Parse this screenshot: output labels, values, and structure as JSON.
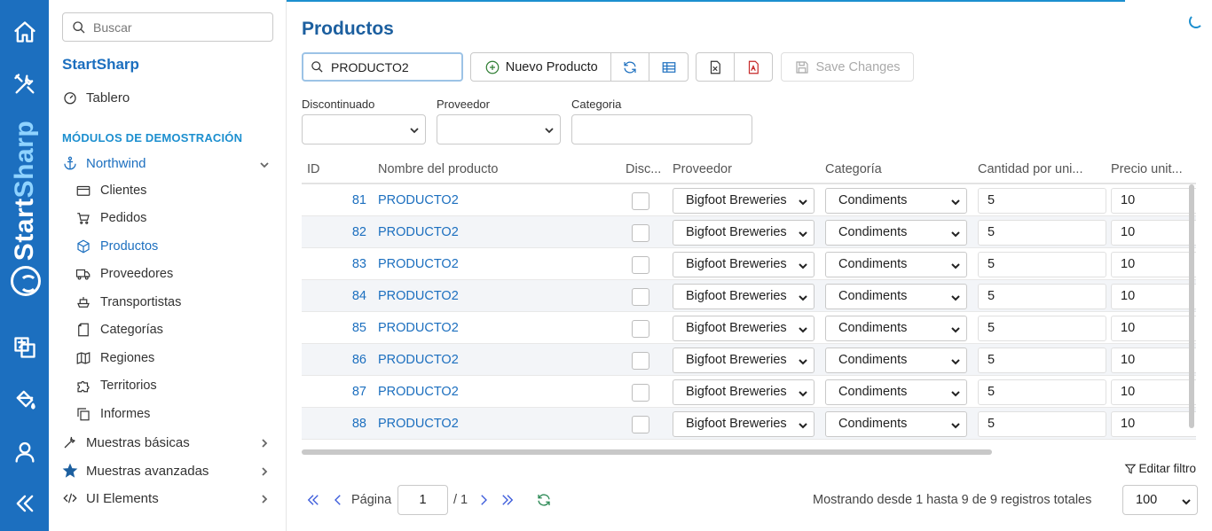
{
  "rail": {
    "brand_start": "Start",
    "brand_sharp": "Sharp",
    "icons": [
      "home-icon",
      "tools-icon",
      "translate-icon",
      "paint-bucket-icon",
      "user-icon",
      "collapse-icon"
    ]
  },
  "sidebar": {
    "search_placeholder": "Buscar",
    "title": "StartSharp",
    "dashboard": "Tablero",
    "section": "MÓDULOS DE DEMOSTRACIÓN",
    "northwind": "Northwind",
    "items": [
      {
        "label": "Clientes",
        "icon": "card-icon"
      },
      {
        "label": "Pedidos",
        "icon": "cart-icon"
      },
      {
        "label": "Productos",
        "icon": "cube-icon"
      },
      {
        "label": "Proveedores",
        "icon": "truck-icon"
      },
      {
        "label": "Transportistas",
        "icon": "ship-icon"
      },
      {
        "label": "Categorías",
        "icon": "folder-icon"
      },
      {
        "label": "Regiones",
        "icon": "map-icon"
      },
      {
        "label": "Territorios",
        "icon": "puzzle-icon"
      },
      {
        "label": "Informes",
        "icon": "copy-icon"
      }
    ],
    "basic": "Muestras básicas",
    "advanced": "Muestras avanzadas",
    "ui": "UI Elements"
  },
  "main": {
    "title": "Productos",
    "quick_search_value": "PRODUCTO2",
    "new_button": "Nuevo Producto",
    "save_changes": "Save Changes",
    "filters": {
      "discontinued_label": "Discontinuado",
      "supplier_label": "Proveedor",
      "category_label": "Categoria"
    },
    "columns": [
      "ID",
      "Nombre del producto",
      "Disc...",
      "Proveedor",
      "Categoría",
      "Cantidad por uni...",
      "Precio unit..."
    ],
    "rows": [
      {
        "id": "81",
        "name": "PRODUCTO2",
        "supplier": "Bigfoot Breweries",
        "category": "Condiments",
        "qty": "5",
        "price": "10"
      },
      {
        "id": "82",
        "name": "PRODUCTO2",
        "supplier": "Bigfoot Breweries",
        "category": "Condiments",
        "qty": "5",
        "price": "10"
      },
      {
        "id": "83",
        "name": "PRODUCTO2",
        "supplier": "Bigfoot Breweries",
        "category": "Condiments",
        "qty": "5",
        "price": "10"
      },
      {
        "id": "84",
        "name": "PRODUCTO2",
        "supplier": "Bigfoot Breweries",
        "category": "Condiments",
        "qty": "5",
        "price": "10"
      },
      {
        "id": "85",
        "name": "PRODUCTO2",
        "supplier": "Bigfoot Breweries",
        "category": "Condiments",
        "qty": "5",
        "price": "10"
      },
      {
        "id": "86",
        "name": "PRODUCTO2",
        "supplier": "Bigfoot Breweries",
        "category": "Condiments",
        "qty": "5",
        "price": "10"
      },
      {
        "id": "87",
        "name": "PRODUCTO2",
        "supplier": "Bigfoot Breweries",
        "category": "Condiments",
        "qty": "5",
        "price": "10"
      },
      {
        "id": "88",
        "name": "PRODUCTO2",
        "supplier": "Bigfoot Breweries",
        "category": "Condiments",
        "qty": "5",
        "price": "10"
      }
    ],
    "edit_filter": "Editar filtro",
    "pager": {
      "page_label": "Página",
      "page_value": "1",
      "total_pages": "/ 1",
      "summary": "Mostrando desde 1 hasta 9 de 9 registros totales",
      "page_size": "100"
    }
  },
  "colors": {
    "accent": "#1c6fbf",
    "rail": "#1c6fbf"
  }
}
